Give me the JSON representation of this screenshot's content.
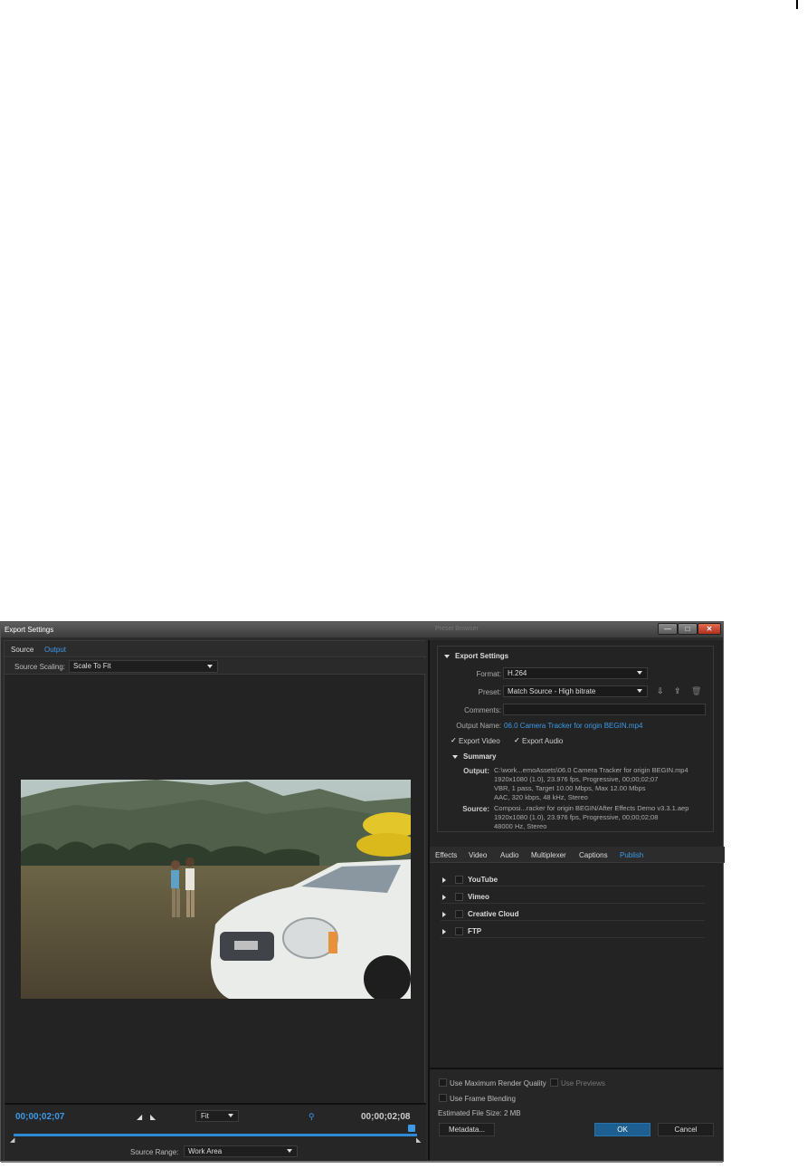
{
  "window": {
    "title": "Export Settings",
    "ghost_title": "Preset Browser",
    "min_glyph": "—",
    "max_glyph": "□",
    "close_glyph": "✕"
  },
  "left": {
    "tabs": [
      {
        "label": "Source",
        "active": false
      },
      {
        "label": "Output",
        "active": true
      }
    ],
    "source_scaling_label": "Source Scaling:",
    "source_scaling_value": "Scale To Fit"
  },
  "timeline": {
    "current_timecode": "00;00;02;07",
    "end_timecode": "00;00;02;08",
    "mark_in_glyph": "◢",
    "mark_out_glyph": "◣",
    "zoom_value": "Fit",
    "snap_icon_glyph": "⚲",
    "start_marker_glyph": "◢",
    "end_marker_glyph": "◣",
    "playhead_position": 1.0,
    "source_range_label": "Source Range:",
    "source_range_value": "Work Area"
  },
  "export_settings": {
    "section_title": "Export Settings",
    "format_label": "Format:",
    "format_value": "H.264",
    "preset_label": "Preset:",
    "preset_value": "Match Source - High bitrate",
    "preset_icons": {
      "save": "⇩",
      "import": "⇪",
      "delete": "🗑"
    },
    "comments_label": "Comments:",
    "comments_value": "",
    "output_name_label": "Output Name:",
    "output_name_value": "06.0  Camera Tracker for origin BEGIN.mp4",
    "export_video_label": "Export Video",
    "export_video_checked": true,
    "export_audio_label": "Export Audio",
    "export_audio_checked": true,
    "check_glyph": "✓",
    "summary_title": "Summary",
    "output_label": "Output:",
    "output_lines": [
      "C:\\work...emoAssets\\06.0  Camera Tracker for origin BEGIN.mp4",
      "1920x1080 (1.0), 23.976 fps, Progressive, 00;00;02;07",
      "VBR, 1 pass, Target 10.00 Mbps, Max 12.00 Mbps",
      "AAC, 320 kbps, 48 kHz, Stereo"
    ],
    "source_label": "Source:",
    "source_lines": [
      "Composi...racker for origin BEGIN/After Effects Demo  v3.3.1.aep",
      "1920x1080 (1.0), 23.976 fps, Progressive, 00;00;02;08",
      "48000 Hz, Stereo"
    ]
  },
  "settings_tabs": [
    {
      "label": "Effects",
      "active": false
    },
    {
      "label": "Video",
      "active": false
    },
    {
      "label": "Audio",
      "active": false
    },
    {
      "label": "Multiplexer",
      "active": false
    },
    {
      "label": "Captions",
      "active": false
    },
    {
      "label": "Publish",
      "active": true
    }
  ],
  "publish_items": [
    {
      "label": "YouTube",
      "checked": false
    },
    {
      "label": "Vimeo",
      "checked": false
    },
    {
      "label": "Creative Cloud",
      "checked": false
    },
    {
      "label": "FTP",
      "checked": false
    }
  ],
  "bottom": {
    "max_render_label": "Use Maximum Render Quality",
    "max_render_checked": false,
    "previews_label": "Use Previews",
    "previews_checked": false,
    "frame_blending_label": "Use Frame Blending",
    "frame_blending_checked": false,
    "file_size_label": "Estimated File Size:",
    "file_size_value": "2 MB",
    "metadata_button": "Metadata...",
    "ok_button": "OK",
    "cancel_button": "Cancel"
  },
  "colors": {
    "accent": "#3d9ae8",
    "panel_bg": "#232323",
    "ok_button": "#1d5f90"
  }
}
